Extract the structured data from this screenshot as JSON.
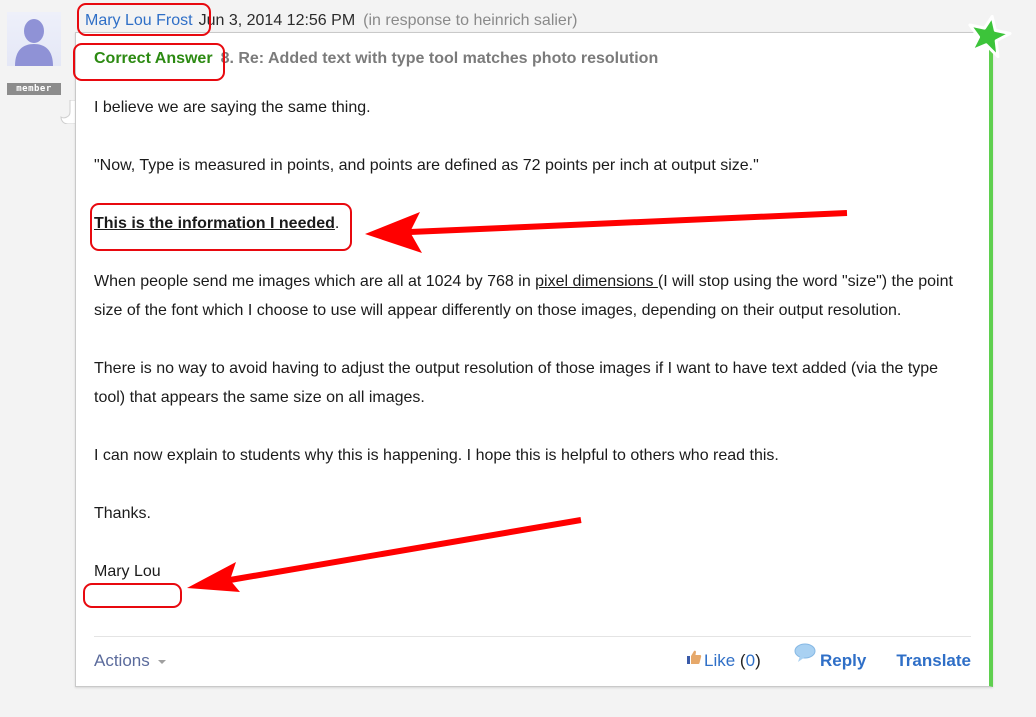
{
  "post": {
    "author": "Mary Lou Frost",
    "date": "Jun 3, 2014 12:56 PM",
    "in_response": "(in response to heinrich salier)",
    "badge": "member",
    "correct_label": "Correct Answer",
    "subject": "8. Re: Added text with type tool matches photo resolution",
    "body": {
      "p1": "I believe we are saying the same thing.",
      "p2": "\"Now, Type is measured in points, and points are defined as 72 points per inch at output size.\"",
      "p3": "This is the information I needed",
      "p3_end": ".",
      "p4_a": "When people send me images which are all at 1024 by 768 in ",
      "p4_link": "pixel dimensions ",
      "p4_b": "(I will stop using the word \"size\") the point size of the font which I choose to use will appear differently on those images, depending on their output resolution.",
      "p5": "There is no way to avoid having to adjust the output resolution of those images if I want to have text added (via the type tool) that appears the same size on all images.",
      "p6": "I can now explain to students why this is happening.  I hope this is helpful to others who read this.",
      "p7": "Thanks.",
      "signature": "Mary Lou"
    }
  },
  "footer": {
    "actions_label": "Actions",
    "like_label": "Like",
    "like_open": "(",
    "like_count": "0",
    "like_close": ")",
    "reply_label": "Reply",
    "translate_label": "Translate"
  },
  "icons": {
    "avatar": "user-silhouette-icon",
    "star": "green-star-icon",
    "like": "thumbs-up-icon",
    "reply": "speech-bubble-icon",
    "actions_caret": "caret-down-icon"
  },
  "colors": {
    "link": "#2f6fc7",
    "correct": "#2c8a12",
    "accent_border": "#5fcf4f",
    "annotation": "#e8090f"
  }
}
